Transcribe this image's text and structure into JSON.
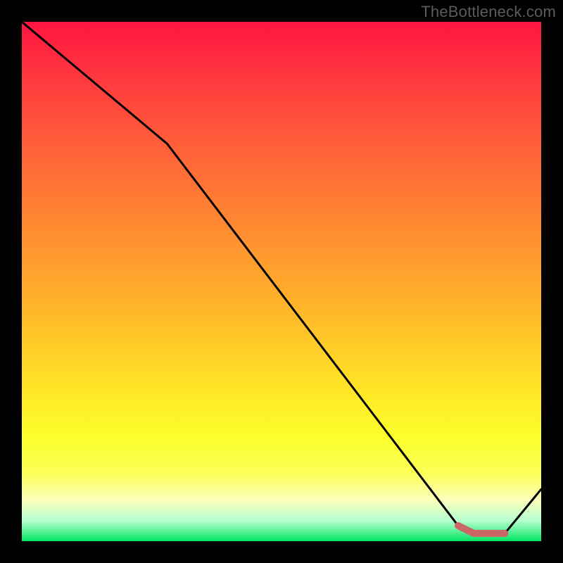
{
  "watermark": "TheBottleneck.com",
  "chart_data": {
    "type": "line",
    "title": "",
    "xlabel": "",
    "ylabel": "",
    "xlim": [
      0,
      100
    ],
    "ylim": [
      0,
      100
    ],
    "series": [
      {
        "name": "black-line",
        "color": "#000000",
        "points": [
          {
            "x": 0,
            "y": 100
          },
          {
            "x": 28,
            "y": 76.5
          },
          {
            "x": 84,
            "y": 3
          },
          {
            "x": 87,
            "y": 1.5
          },
          {
            "x": 93,
            "y": 1.5
          },
          {
            "x": 100,
            "y": 10
          }
        ]
      },
      {
        "name": "pink-segment",
        "color": "#cc6666",
        "points": [
          {
            "x": 84,
            "y": 3
          },
          {
            "x": 87,
            "y": 1.5
          },
          {
            "x": 93,
            "y": 1.5
          }
        ]
      }
    ],
    "background_gradient": {
      "top": "#ff1540",
      "mid": "#ffe326",
      "bottom": "#00e561"
    }
  }
}
